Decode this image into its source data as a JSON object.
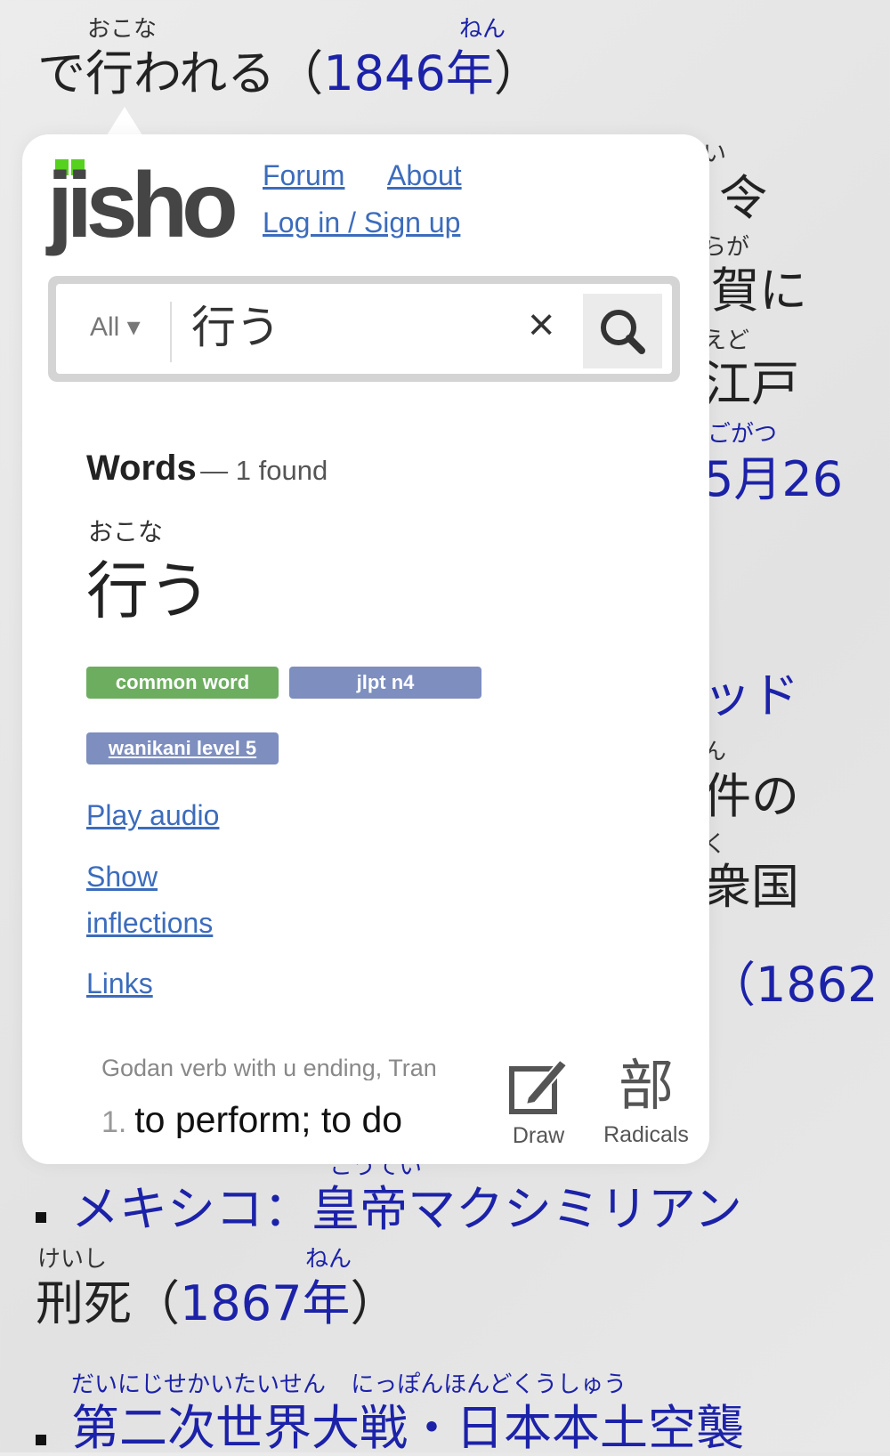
{
  "background": {
    "line1": {
      "ruby1": "おこな",
      "ruby2": "ねん",
      "text_black": "で行われる（",
      "text_blue": "1846年",
      "text_end": "）"
    },
    "right": [
      {
        "text": "い",
        "blue": false,
        "ruby": true
      },
      {
        "text": "令",
        "blue": false,
        "ruby": false
      },
      {
        "text": "らが",
        "blue": false,
        "ruby": true
      },
      {
        "text": "浦賀に",
        "blue": false,
        "ruby": false
      },
      {
        "text": "えど",
        "blue": false,
        "ruby": true
      },
      {
        "text": "江戸",
        "blue": false,
        "ruby": false
      },
      {
        "text": "ごがつ",
        "blue": true,
        "ruby": true
      },
      {
        "text": "5月26",
        "blue": true,
        "ruby": false
      },
      {
        "text": "ッド",
        "blue": true,
        "ruby": false
      },
      {
        "text": "ん",
        "blue": false,
        "ruby": true
      },
      {
        "text": "件の",
        "blue": false,
        "ruby": false
      },
      {
        "text": "く",
        "blue": false,
        "ruby": true
      },
      {
        "text": "衆国",
        "blue": false,
        "ruby": false
      },
      {
        "text": "（1862",
        "blue": true,
        "ruby": false
      }
    ],
    "mexico": {
      "ruby": "こうてい",
      "text": "メキシコ：皇帝マクシミリアン"
    },
    "execution": {
      "ruby1": "けいし",
      "ruby2": "ねん",
      "text_black": "刑死（",
      "text_blue": "1867年",
      "text_end": "）"
    },
    "ww2": {
      "ruby": "だいにじせかいたいせん にっぽんほんどくうしゅう",
      "text": "第二次世界大戦・日本本土空襲"
    }
  },
  "popup": {
    "logo": "jisho",
    "nav": {
      "forum": "Forum",
      "about": "About",
      "login": "Log in / Sign up"
    },
    "search": {
      "filter": "All ▾",
      "query": "行う"
    },
    "results": {
      "heading": "Words",
      "count": "— 1 found",
      "furigana": "おこな",
      "word": "行う",
      "badges": [
        {
          "label": "common word",
          "color": "#6dad60"
        },
        {
          "label": "jlpt n4",
          "color": "#7d8ebf"
        },
        {
          "label": "wanikani level 5",
          "color": "#7d8ebf"
        }
      ],
      "links": {
        "audio": "Play audio",
        "show": "Show",
        "inflections": "inflections",
        "links": "Links"
      },
      "pos": "Godan verb with u ending, Tran",
      "sense_num": "1.",
      "sense": "to perform; to do"
    },
    "tools": {
      "draw": "Draw",
      "radicals_glyph": "部",
      "radicals": "Radicals"
    }
  }
}
